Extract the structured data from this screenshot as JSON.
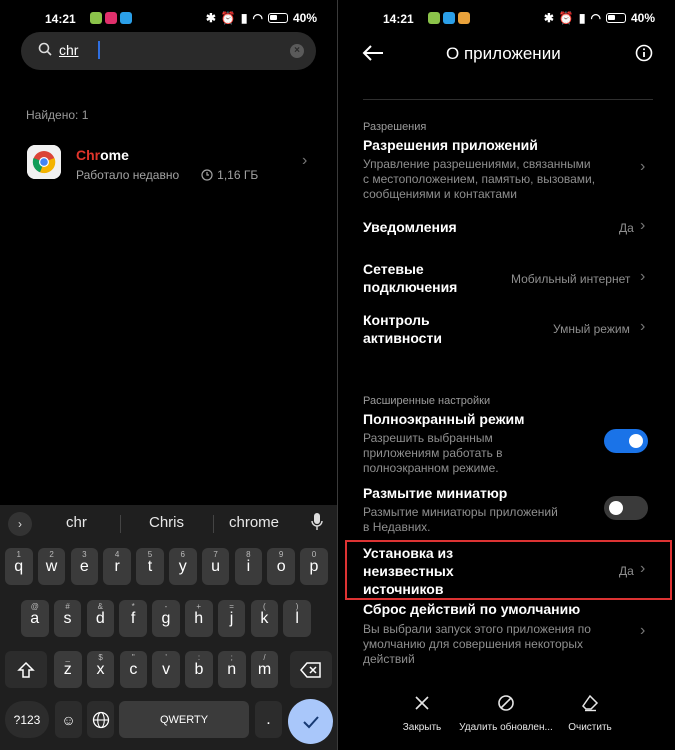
{
  "left_status": {
    "time": "14:21",
    "battery": "40"
  },
  "right_status": {
    "time": "14:21",
    "battery": "40"
  },
  "search": {
    "value": "chr",
    "icon": "search-icon",
    "clear_icon": "clear-icon"
  },
  "results": {
    "found_label": "Найдено: 1",
    "app": {
      "name_highlight": "Chr",
      "name_rest": "ome",
      "status": "Работало недавно",
      "size": "1,16 ГБ"
    }
  },
  "keyboard": {
    "suggestions": [
      "chr",
      "Chris",
      "chrome"
    ],
    "row1": [
      {
        "k": "q",
        "s": "1"
      },
      {
        "k": "w",
        "s": "2"
      },
      {
        "k": "e",
        "s": "3"
      },
      {
        "k": "r",
        "s": "4"
      },
      {
        "k": "t",
        "s": "5"
      },
      {
        "k": "y",
        "s": "6"
      },
      {
        "k": "u",
        "s": "7"
      },
      {
        "k": "i",
        "s": "8"
      },
      {
        "k": "o",
        "s": "9"
      },
      {
        "k": "p",
        "s": "0"
      }
    ],
    "row2": [
      {
        "k": "a",
        "s": "@"
      },
      {
        "k": "s",
        "s": "#"
      },
      {
        "k": "d",
        "s": "&"
      },
      {
        "k": "f",
        "s": "*"
      },
      {
        "k": "g",
        "s": "-"
      },
      {
        "k": "h",
        "s": "+"
      },
      {
        "k": "j",
        "s": "="
      },
      {
        "k": "k",
        "s": "("
      },
      {
        "k": "l",
        "s": ")"
      }
    ],
    "row3": [
      {
        "k": "z",
        "s": "_"
      },
      {
        "k": "x",
        "s": "$"
      },
      {
        "k": "c",
        "s": "\""
      },
      {
        "k": "v",
        "s": "'"
      },
      {
        "k": "b",
        "s": ":"
      },
      {
        "k": "n",
        "s": ";"
      },
      {
        "k": "m",
        "s": "/"
      }
    ],
    "symbols_key": "?123",
    "space_label": "QWERTY",
    "period_key": "."
  },
  "app_info": {
    "title": "О приложении",
    "permissions_section": "Разрешения",
    "rows": {
      "app_permissions": {
        "title": "Разрешения приложений",
        "desc": [
          "Управление разрешениями, связанными",
          "с местоположением, памятью, вызовами,",
          "сообщениями и контактами"
        ]
      },
      "notifications": {
        "title": "Уведомления",
        "value": "Да"
      },
      "network": {
        "title": [
          "Сетевые",
          "подключения"
        ],
        "value": "Мобильный интернет"
      },
      "activity": {
        "title": [
          "Контроль",
          "активности"
        ],
        "value": "Умный режим"
      }
    },
    "advanced_section": "Расширенные настройки",
    "fullscreen": {
      "title": "Полноэкранный режим",
      "desc": [
        "Разрешить выбранным",
        "приложениям работать в",
        "полноэкранном режиме."
      ],
      "enabled": true
    },
    "blur": {
      "title": "Размытие миниатюр",
      "desc": [
        "Размытие миниатюры приложений",
        "в Недавних."
      ],
      "enabled": false
    },
    "unknown_sources": {
      "title": [
        "Установка из",
        "неизвестных",
        "источников"
      ],
      "value": "Да"
    },
    "reset_defaults": {
      "title": "Сброс действий по умолчанию",
      "desc": [
        "Вы выбрали запуск этого приложения по",
        "умолчанию для совершения некоторых",
        "действий"
      ]
    },
    "bottom_actions": [
      "Закрыть",
      "Удалить обновлен...",
      "Очистить"
    ]
  },
  "colors": {
    "accent": "#1a73e8",
    "highlight": "#e0352b",
    "frame": "#dd3333"
  }
}
